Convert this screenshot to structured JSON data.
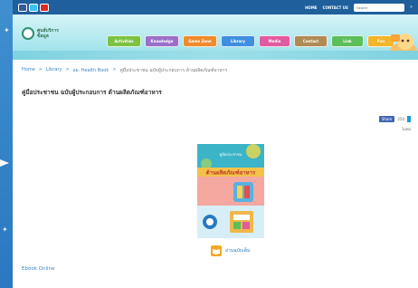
{
  "topbar": {
    "links": [
      "HOME",
      "CONTACT US"
    ],
    "search_placeholder": "Search",
    "go_label": "»"
  },
  "logo": {
    "text_line1": "ศูนย์บริการ",
    "text_line2": "ข้อมูล"
  },
  "nav": {
    "items": [
      "Activities",
      "Knowledge",
      "Game Zone",
      "Library",
      "Media",
      "Contact",
      "Link",
      "Fun"
    ]
  },
  "breadcrumb": {
    "items": [
      "Home",
      "Library",
      "อย. Health Book"
    ],
    "separator": ">",
    "current": "คู่มือประชาชน ฉบับผู้ประกอบการ ด้านผลิตภัณฑ์อาหาร"
  },
  "page": {
    "title": "คู่มือประชาชน ฉบับผู้ประกอบการ ด้านผลิตภัณฑ์อาหาร"
  },
  "share": {
    "button_label": "Share",
    "count": "250",
    "sub_label": "ไม่พบ"
  },
  "cover": {
    "top_label": "คู่มือประชาชน",
    "band_label": "ด้านผลิตภัณฑ์อาหาร"
  },
  "follow": {
    "label": "อ่านฉบับเต็ม"
  },
  "ebook": {
    "label": "Ebook Online"
  },
  "colors": {
    "background": "#2a78c2",
    "topbar": "#1f5f9c",
    "link": "#3a86c8"
  }
}
